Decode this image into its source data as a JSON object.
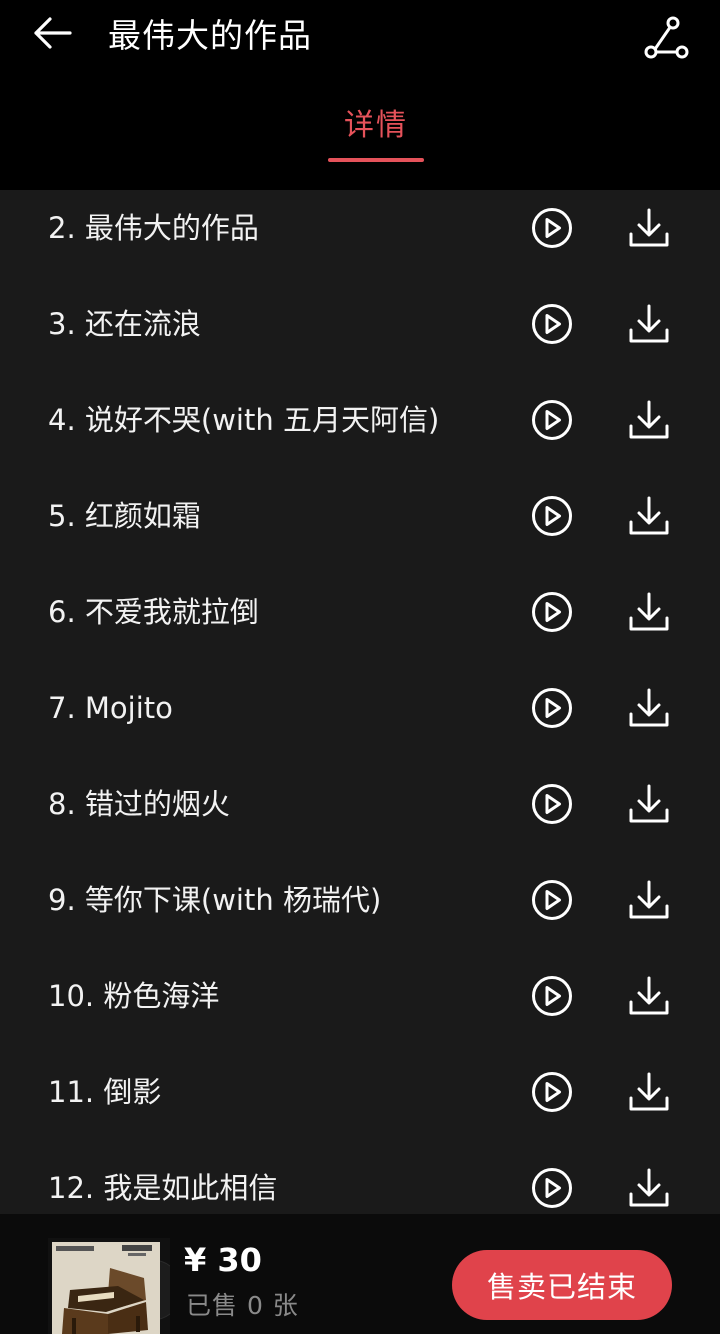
{
  "header": {
    "title": "最伟大的作品",
    "back_icon": "arrow-left-icon",
    "share_icon": "share-icon"
  },
  "tabs": [
    {
      "label": "详情",
      "active": true
    }
  ],
  "tracks": [
    {
      "title": "2. 最伟大的作品"
    },
    {
      "title": "3. 还在流浪"
    },
    {
      "title": "4. 说好不哭(with 五月天阿信)"
    },
    {
      "title": "5. 红颜如霜"
    },
    {
      "title": "6. 不爱我就拉倒"
    },
    {
      "title": "7. Mojito"
    },
    {
      "title": "8. 错过的烟火"
    },
    {
      "title": "9. 等你下课(with 杨瑞代)"
    },
    {
      "title": "10. 粉色海洋"
    },
    {
      "title": "11. 倒影"
    },
    {
      "title": "12. 我是如此相信"
    }
  ],
  "track_icons": {
    "play": "play-circle-icon",
    "download": "download-icon"
  },
  "bottom_bar": {
    "price": "¥ 30",
    "sold": "已售 0 张",
    "sale_button": "售卖已结束"
  },
  "colors": {
    "accent": "#e5525a",
    "button": "#e0434b",
    "list_background": "#1a1a1a",
    "header_background": "#000000"
  }
}
